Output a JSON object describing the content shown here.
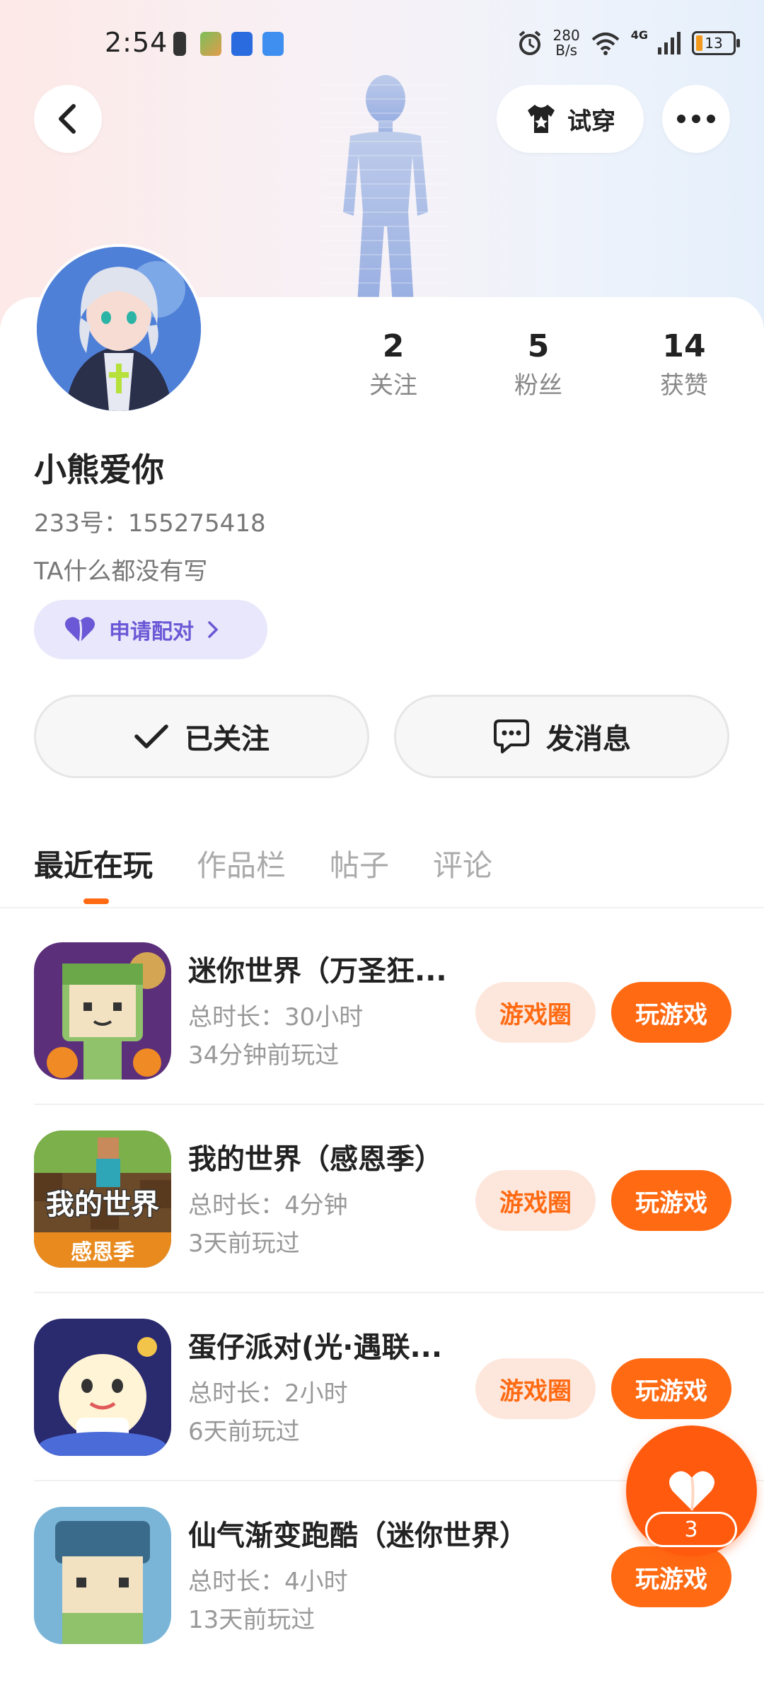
{
  "status_bar": {
    "time": "2:54",
    "net_speed_value": "280",
    "net_speed_unit": "B/s",
    "network": "4G",
    "battery": "13"
  },
  "header": {
    "try_on_label": "试穿"
  },
  "profile": {
    "stats": [
      {
        "value": "2",
        "label": "关注"
      },
      {
        "value": "5",
        "label": "粉丝"
      },
      {
        "value": "14",
        "label": "获赞"
      }
    ],
    "nickname": "小熊爱你",
    "user_id": "233号：155275418",
    "bio": "TA什么都没有写",
    "pair_label": "申请配对"
  },
  "actions": {
    "follow_label": "已关注",
    "message_label": "发消息"
  },
  "tabs": [
    "最近在玩",
    "作品栏",
    "帖子",
    "评论"
  ],
  "games": [
    {
      "title": "迷你世界（万圣狂...",
      "duration": "总时长：30小时",
      "last_played": "34分钟前玩过",
      "circle_label": "游戏圈",
      "play_label": "玩游戏"
    },
    {
      "title": "我的世界（感恩季）",
      "duration": "总时长：4分钟",
      "last_played": "3天前玩过",
      "circle_label": "游戏圈",
      "play_label": "玩游戏",
      "icon_text_top": "我的世界",
      "icon_text_bottom": "感恩季"
    },
    {
      "title": "蛋仔派对(光·遇联...",
      "duration": "总时长：2小时",
      "last_played": "6天前玩过",
      "circle_label": "游戏圈",
      "play_label": "玩游戏"
    },
    {
      "title": "仙气渐变跑酷（迷你世界）",
      "duration": "总时长：4小时",
      "last_played": "13天前玩过",
      "play_label": "玩游戏"
    }
  ],
  "fab": {
    "like_count": "3"
  },
  "colors": {
    "accent": "#ff6a13",
    "pair_text": "#6a58d6",
    "pair_bg": "#e9e7fb"
  }
}
